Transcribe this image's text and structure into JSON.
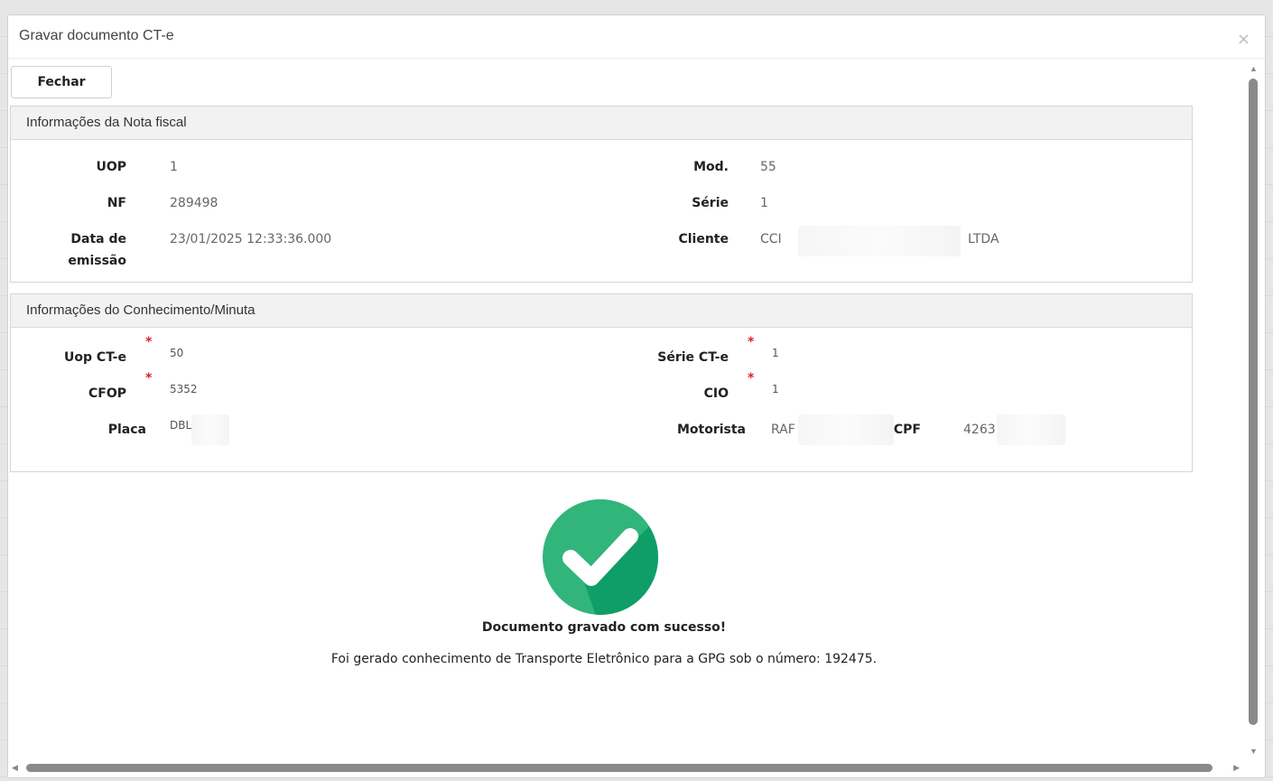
{
  "dialog": {
    "title": "Gravar documento CT-e",
    "close_glyph": "×"
  },
  "toolbar": {
    "close_label": "Fechar"
  },
  "nf_panel": {
    "title": "Informações da Nota fiscal",
    "uop_label": "UOP",
    "uop_value": "1",
    "nf_label": "NF",
    "nf_value": "289498",
    "date_label_line1": "Data de",
    "date_label_line2": "emissão",
    "date_value": "23/01/2025 12:33:36.000",
    "mod_label": "Mod.",
    "mod_value": "55",
    "serie_label": "Série",
    "serie_value": "1",
    "cliente_label": "Cliente",
    "cliente_value_start": "CCI",
    "cliente_value_end": "LTDA"
  },
  "cte_panel": {
    "title": "Informações do Conhecimento/Minuta",
    "required_mark": "*",
    "uop_cte_label": "Uop CT-e",
    "uop_cte_value": "50",
    "cfop_label": "CFOP",
    "cfop_value": "5352",
    "placa_label": "Placa",
    "placa_value": "DBL",
    "serie_cte_label": "Série CT-e",
    "serie_cte_value": "1",
    "cio_label": "CIO",
    "cio_value": "1",
    "motorista_label": "Motorista",
    "motorista_value": "RAF",
    "cpf_label": "CPF",
    "cpf_value": "4263"
  },
  "result": {
    "title": "Documento gravado com sucesso!",
    "message": "Foi gerado conhecimento de Transporte Eletrônico para a GPG sob o número: 192475."
  },
  "scrollbars": {
    "up": "▲",
    "down": "▼",
    "left": "◀",
    "right": "▶"
  },
  "colors": {
    "success_green": "#31b57a",
    "success_green_dark": "#0f9e68",
    "required_red": "#e02020"
  }
}
